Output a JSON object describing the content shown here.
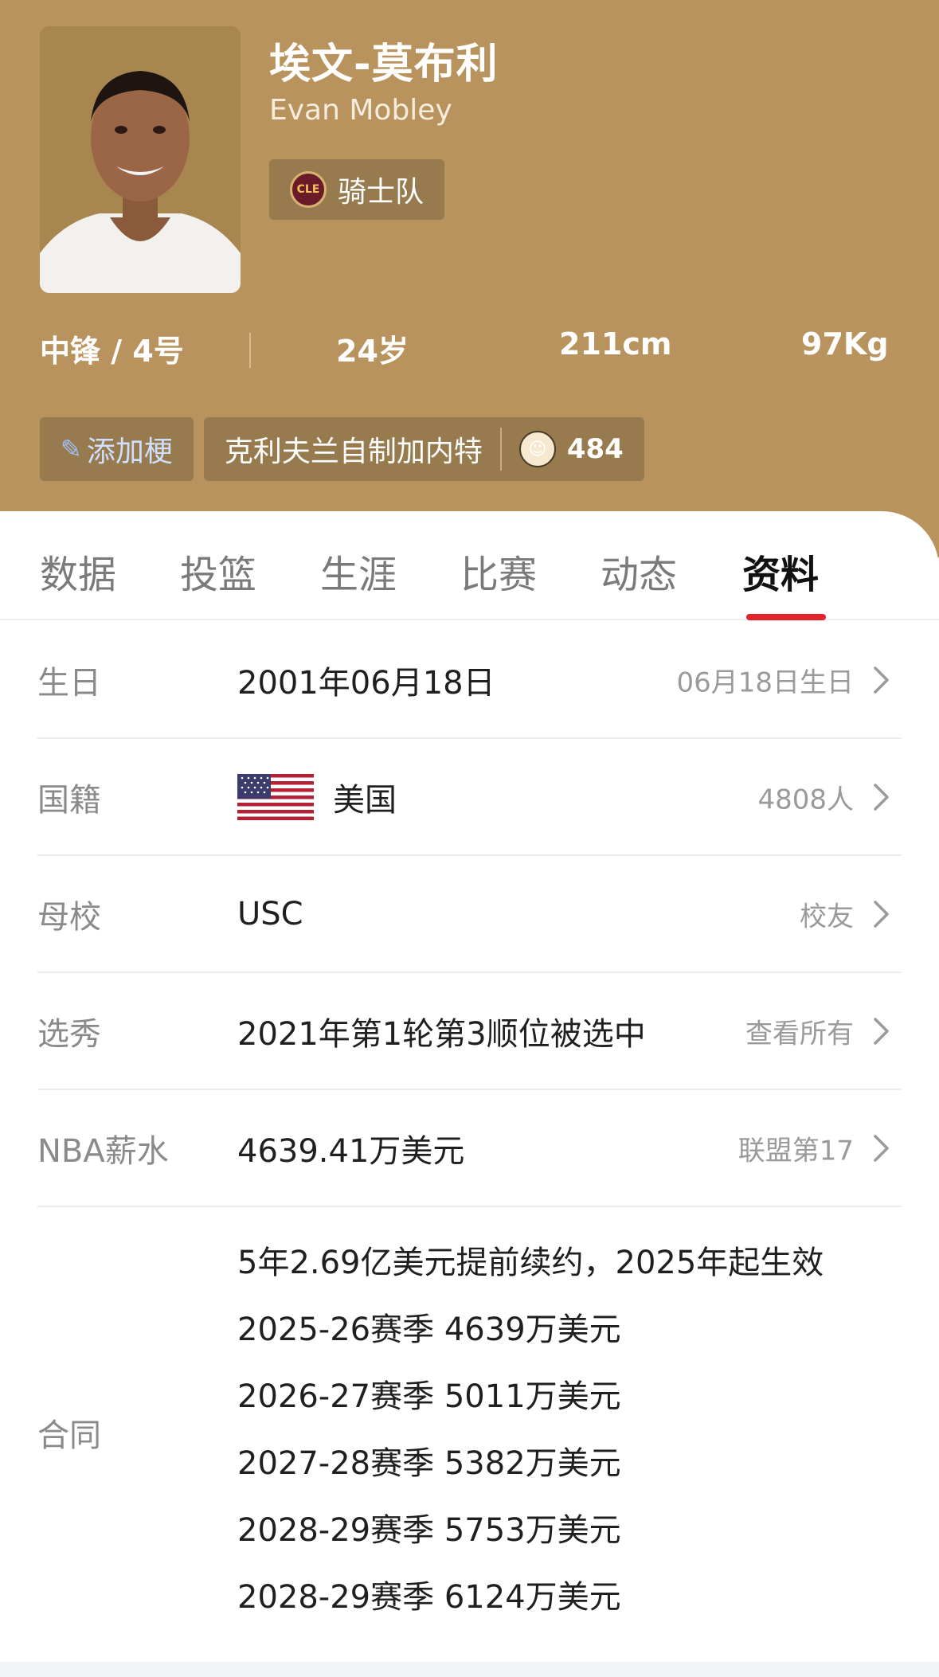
{
  "player": {
    "name_cn": "埃文-莫布利",
    "name_en": "Evan Mobley",
    "team": "骑士队",
    "team_logo_text": "CLE"
  },
  "stats": {
    "position": "中锋 / 4号",
    "age": "24岁",
    "height": "211cm",
    "weight": "97Kg"
  },
  "tags": {
    "add_meme": "添加梗",
    "meme_text": "克利夫兰自制加内特",
    "meme_count": "484"
  },
  "tabs": [
    {
      "label": "数据"
    },
    {
      "label": "投篮"
    },
    {
      "label": "生涯"
    },
    {
      "label": "比赛"
    },
    {
      "label": "动态"
    },
    {
      "label": "资料"
    }
  ],
  "active_tab": "资料",
  "rows": [
    {
      "label": "生日",
      "value": "2001年06月18日",
      "aside": "06月18日生日"
    },
    {
      "label": "国籍",
      "value": "美国",
      "aside": "4808人"
    },
    {
      "label": "母校",
      "value": "USC",
      "aside": "校友"
    },
    {
      "label": "选秀",
      "value": "2021年第1轮第3顺位被选中",
      "aside": "查看所有"
    },
    {
      "label": "NBA薪水",
      "value": "4639.41万美元",
      "aside": "联盟第17"
    }
  ],
  "contract": {
    "label": "合同",
    "lines": [
      "5年2.69亿美元提前续约，2025年起生效",
      "2025-26赛季 4639万美元",
      "2026-27赛季 5011万美元",
      "2027-28赛季 5382万美元",
      "2028-29赛季 5753万美元",
      "2028-29赛季 6124万美元"
    ]
  },
  "colors": {
    "header_bg": "#b9935d",
    "badge_bg": "#977a4d",
    "accent_red": "#e3222b"
  },
  "icons": {
    "pencil": "pencil-icon",
    "chevron": "chevron-right-icon",
    "flag": "us-flag-icon"
  }
}
